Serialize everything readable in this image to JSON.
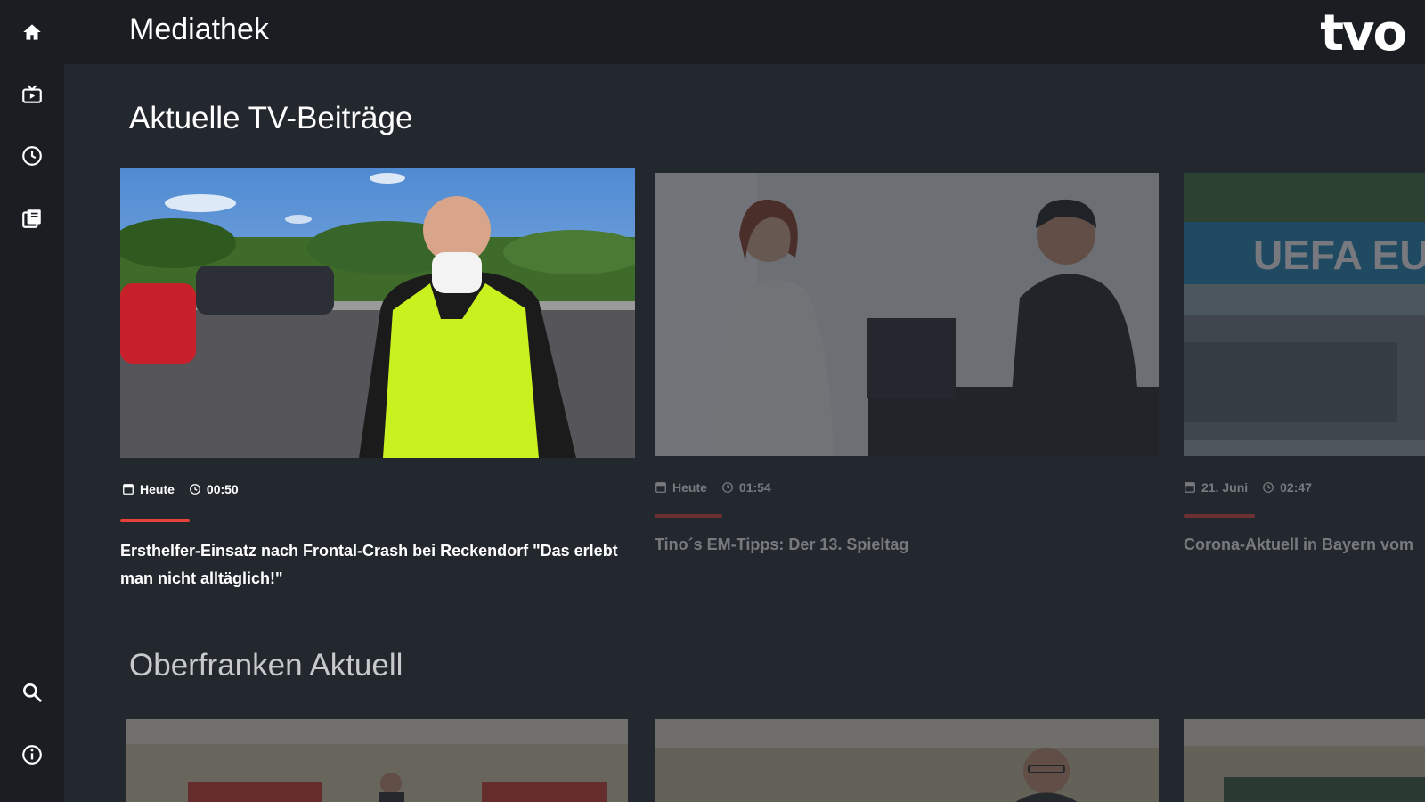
{
  "header": {
    "title": "Mediathek",
    "logo_text": "tvo"
  },
  "sidebar": {
    "items": [
      {
        "name": "home",
        "icon": "home-icon"
      },
      {
        "name": "live-tv",
        "icon": "tv-icon"
      },
      {
        "name": "recent",
        "icon": "clock-icon"
      },
      {
        "name": "library",
        "icon": "library-icon"
      },
      {
        "name": "search",
        "icon": "search-icon"
      },
      {
        "name": "info",
        "icon": "info-icon"
      }
    ]
  },
  "sections": [
    {
      "title": "Aktuelle TV-Beiträge",
      "cards": [
        {
          "date": "Heute",
          "duration": "00:50",
          "title": "Ersthelfer-Einsatz nach Frontal-Crash bei Reckendorf \"Das erlebt man nicht alltäglich!\"",
          "focused": true
        },
        {
          "date": "Heute",
          "duration": "01:54",
          "title": "Tino´s EM-Tipps: Der 13. Spieltag",
          "focused": false
        },
        {
          "date": "21. Juni",
          "duration": "02:47",
          "title": "Corona-Aktuell in Bayern vom",
          "focused": false,
          "thumb_text": "UEFA EU"
        }
      ]
    },
    {
      "title": "Oberfranken Aktuell",
      "cards": [
        {},
        {},
        {}
      ]
    }
  ],
  "colors": {
    "accent": "#e8413a",
    "background": "#23272e",
    "bar": "#1a1d22"
  }
}
